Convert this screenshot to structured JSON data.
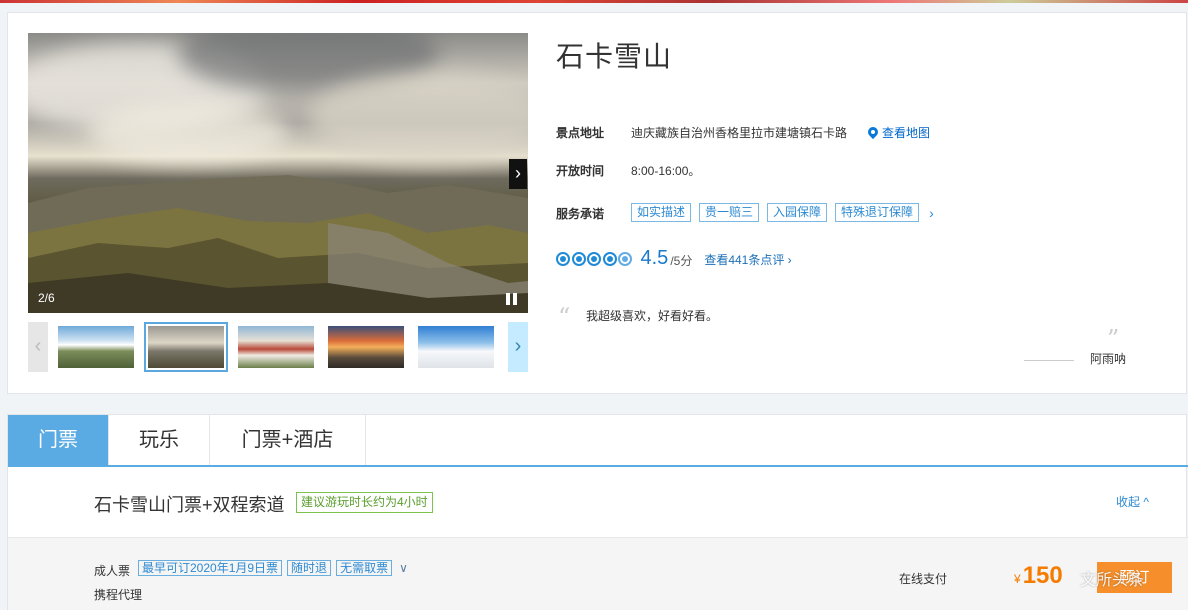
{
  "gallery": {
    "counter": "2/6",
    "thumbnails": [
      {
        "name": "mountain-snow-thumb"
      },
      {
        "name": "cloudy-valley-thumb"
      },
      {
        "name": "temple-thumb"
      },
      {
        "name": "sunset-road-thumb"
      },
      {
        "name": "snow-slope-thumb"
      }
    ]
  },
  "attraction": {
    "title": "石卡雪山",
    "address_label": "景点地址",
    "address": "迪庆藏族自治州香格里拉市建塘镇石卡路",
    "map_link": "查看地图",
    "hours_label": "开放时间",
    "hours": "8:00-16:00。",
    "service_label": "服务承诺",
    "service_tags": [
      "如实描述",
      "贵一赔三",
      "入园保障",
      "特殊退订保障"
    ],
    "service_more": "›",
    "rating": {
      "score": "4.5",
      "unit": "/5分",
      "reviews_link": "查看441条点评 ›"
    },
    "review": {
      "quote_open": "“",
      "quote_close": "”",
      "text": "我超级喜欢，好看好看。",
      "author": "阿雨呐"
    }
  },
  "tabs": [
    {
      "label": "门票"
    },
    {
      "label": "玩乐"
    },
    {
      "label": "门票+酒店"
    }
  ],
  "product": {
    "title": "石卡雪山门票+双程索道",
    "badge": "建议游玩时长约为4小时",
    "collapse": "收起 ^",
    "ticket": {
      "type": "成人票",
      "tags": [
        "最早可订2020年1月9日票",
        "随时退",
        "无需取票"
      ],
      "tags_more": "∨",
      "agent": "携程代理",
      "payment": "在线支付",
      "currency": "¥",
      "price": "150",
      "book_label": "预订"
    }
  },
  "watermark": "文所头条",
  "colors": {
    "accent": "#5aabe3",
    "link": "#2d8ad2",
    "price": "#f57c00",
    "book_button": "#f68f2b",
    "badge_green": "#5a9e2e"
  }
}
